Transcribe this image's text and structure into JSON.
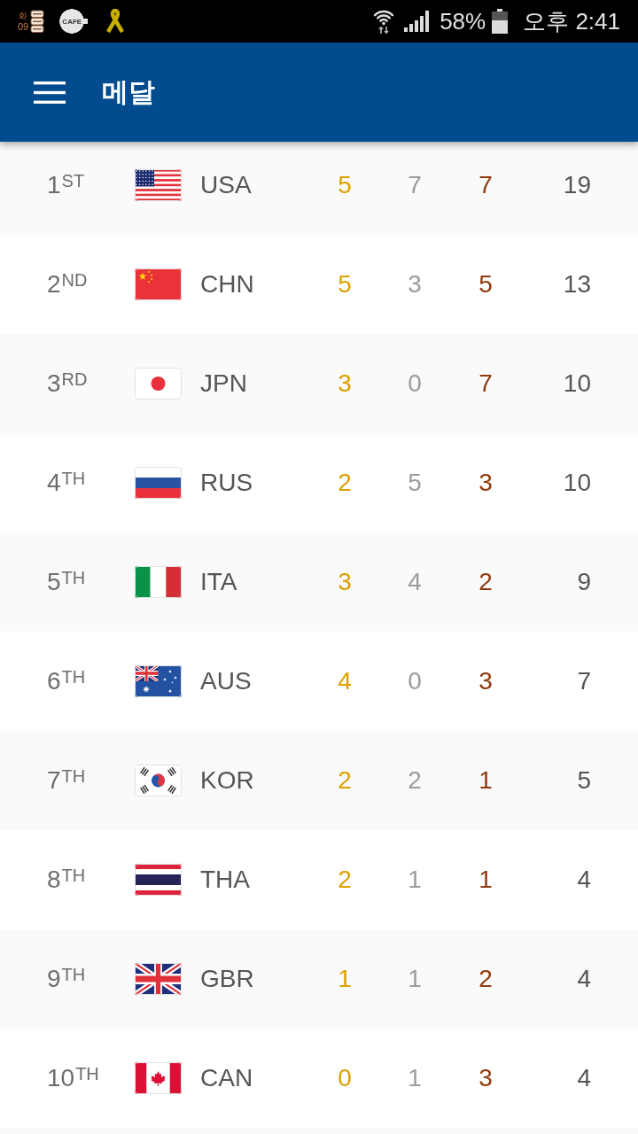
{
  "status_bar": {
    "notifications": [
      {
        "kind": "calendar",
        "day": "화",
        "date": "09"
      },
      {
        "kind": "cafe",
        "label": "CAFE"
      },
      {
        "kind": "ribbon"
      }
    ],
    "battery": "58%",
    "time": "오후 2:41"
  },
  "app_bar": {
    "title": "메달"
  },
  "medal_table": {
    "rows": [
      {
        "rank": "1$^{ST}$",
        "flag": {
          "kind": "usa"
        },
        "country": "USA",
        "gold": "5",
        "silver": "7",
        "bronze": "7",
        "total": "19"
      },
      {
        "rank": "2$^{ND}$",
        "flag": {
          "kind": "chn"
        },
        "country": "CHN",
        "gold": "5",
        "silver": "3",
        "bronze": "5",
        "total": "13"
      },
      {
        "rank": "3$^{RD}$",
        "flag": {
          "kind": "jpn"
        },
        "country": "JPN",
        "gold": "3",
        "silver": "0",
        "bronze": "7",
        "total": "10"
      },
      {
        "rank": "4$^{TH}$",
        "flag": {
          "kind": "rus"
        },
        "country": "RUS",
        "gold": "2",
        "silver": "5",
        "bronze": "3",
        "total": "10"
      },
      {
        "rank": "5$^{TH}$",
        "flag": {
          "kind": "ita"
        },
        "country": "ITA",
        "gold": "3",
        "silver": "4",
        "bronze": "2",
        "total": "9"
      },
      {
        "rank": "6$^{TH}$",
        "flag": {
          "kind": "aus"
        },
        "country": "AUS",
        "gold": "4",
        "silver": "0",
        "bronze": "3",
        "total": "7"
      },
      {
        "rank": "7$^{TH}$",
        "flag": {
          "kind": "kor"
        },
        "country": "KOR",
        "gold": "2",
        "silver": "2",
        "bronze": "1",
        "total": "5"
      },
      {
        "rank": "8$^{TH}$",
        "flag": {
          "kind": "tha"
        },
        "country": "THA",
        "gold": "2",
        "silver": "1",
        "bronze": "1",
        "total": "4"
      },
      {
        "rank": "9$^{TH}$",
        "flag": {
          "kind": "gbr"
        },
        "country": "GBR",
        "gold": "1",
        "silver": "1",
        "bronze": "2",
        "total": "4"
      },
      {
        "rank": "10$^{TH}$",
        "flag": {
          "kind": "can"
        },
        "country": "CAN",
        "gold": "0",
        "silver": "1",
        "bronze": "3",
        "total": "4"
      }
    ]
  }
}
